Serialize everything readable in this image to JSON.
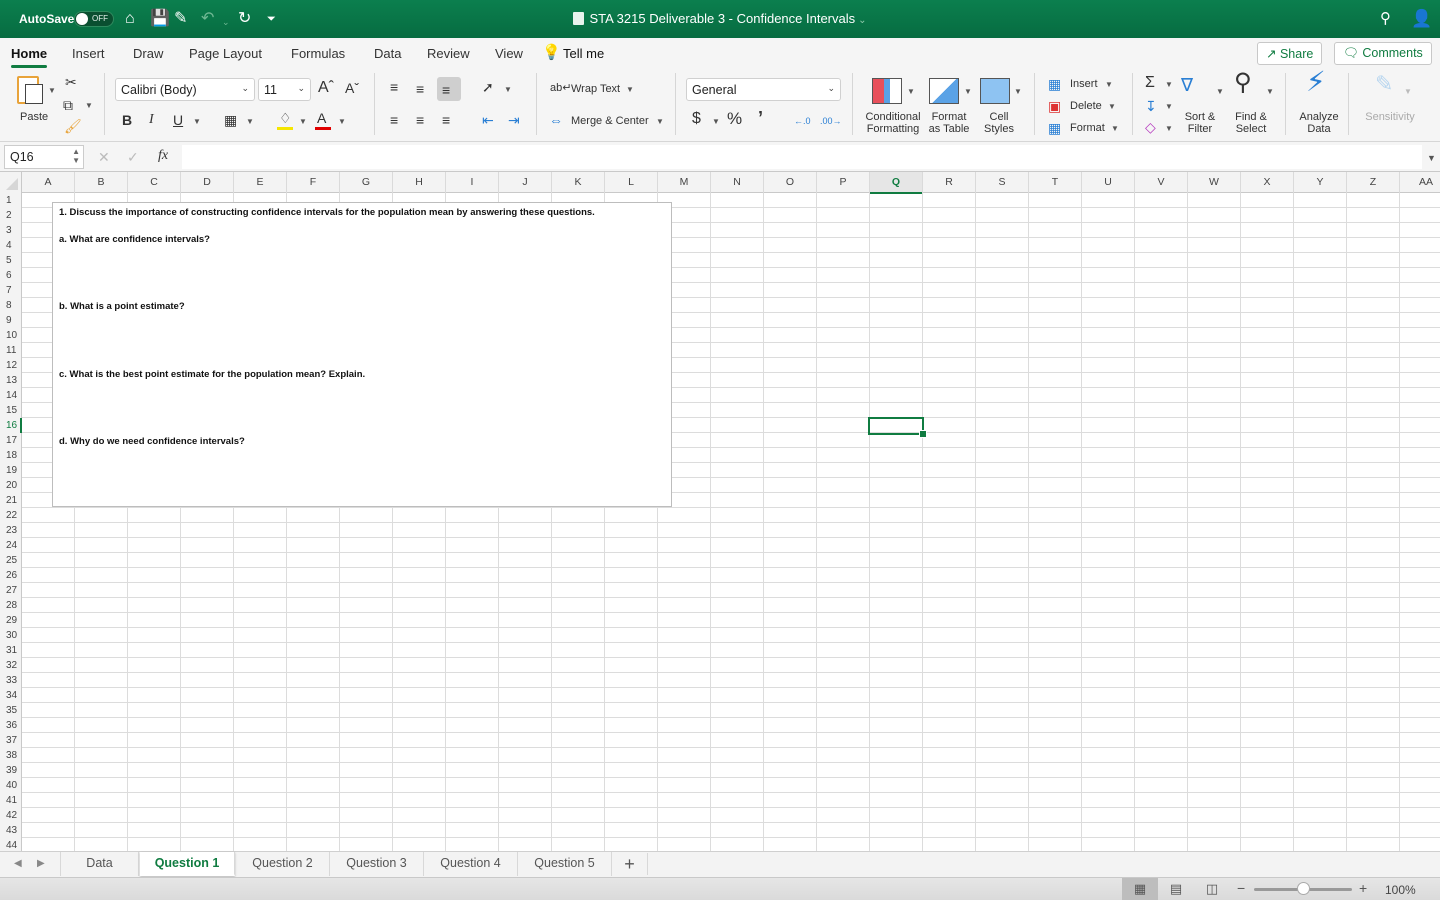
{
  "titlebar": {
    "autosave_label": "AutoSave",
    "autosave_state": "OFF",
    "document_title": "STA 3215 Deliverable 3 - Confidence Intervals",
    "icons": [
      "home-icon",
      "save-icon",
      "edit-icon",
      "undo-icon",
      "redo-icon",
      "customize-icon",
      "search-icon",
      "account-icon"
    ]
  },
  "ribbon_tabs": [
    "Home",
    "Insert",
    "Draw",
    "Page Layout",
    "Formulas",
    "Data",
    "Review",
    "View"
  ],
  "active_tab": "Home",
  "tell_me": "Tell me",
  "share_label": "Share",
  "comments_label": "Comments",
  "ribbon": {
    "paste_label": "Paste",
    "font_name": "Calibri (Body)",
    "font_size": "11",
    "bold": "B",
    "italic": "I",
    "underline": "U",
    "wrap_text": "Wrap Text",
    "merge_center": "Merge & Center",
    "number_format": "General",
    "currency": "$",
    "percent": "%",
    "comma": "’",
    "conditional_formatting": [
      "Conditional",
      "Formatting"
    ],
    "format_as_table": [
      "Format",
      "as Table"
    ],
    "cell_styles": [
      "Cell",
      "Styles"
    ],
    "insert": "Insert",
    "delete": "Delete",
    "format": "Format",
    "sort_filter": [
      "Sort &",
      "Filter"
    ],
    "find_select": [
      "Find &",
      "Select"
    ],
    "analyze_data": [
      "Analyze",
      "Data"
    ],
    "sensitivity": "Sensitivity",
    "colors": {
      "highlight": "#f5e600",
      "font_color": "#e00000",
      "accent": "#107c41"
    }
  },
  "formula_bar": {
    "name_box": "Q16",
    "fx": "fx",
    "formula": ""
  },
  "columns": [
    "A",
    "B",
    "C",
    "D",
    "E",
    "F",
    "G",
    "H",
    "I",
    "J",
    "K",
    "L",
    "M",
    "N",
    "O",
    "P",
    "Q",
    "R",
    "S",
    "T",
    "U",
    "V",
    "W",
    "X",
    "Y",
    "Z",
    "AA"
  ],
  "selected_column": "Q",
  "rows": [
    "1",
    "2",
    "3",
    "4",
    "5",
    "6",
    "7",
    "8",
    "9",
    "10",
    "11",
    "12",
    "13",
    "14",
    "15",
    "16",
    "17",
    "18",
    "19",
    "20",
    "21",
    "22",
    "23",
    "24",
    "25",
    "26",
    "27",
    "28",
    "29",
    "30",
    "31",
    "32",
    "33",
    "34",
    "35",
    "36",
    "37",
    "38",
    "39",
    "40",
    "41",
    "42",
    "43",
    "44"
  ],
  "selected_row": "16",
  "textbox": {
    "heading": "1. Discuss the importance of constructing confidence intervals for the population mean by answering these questions.",
    "q_a": "a. What are confidence intervals?",
    "q_b": "b. What is a point estimate?",
    "q_c": "c. What is the best point estimate for the population mean? Explain.",
    "q_d": "d. Why do we need confidence intervals?"
  },
  "sheets": [
    "Data",
    "Question 1",
    "Question 2",
    "Question 3",
    "Question 4",
    "Question 5"
  ],
  "active_sheet": "Question 1",
  "status": {
    "zoom": "100%",
    "zoom_percent": 100
  }
}
